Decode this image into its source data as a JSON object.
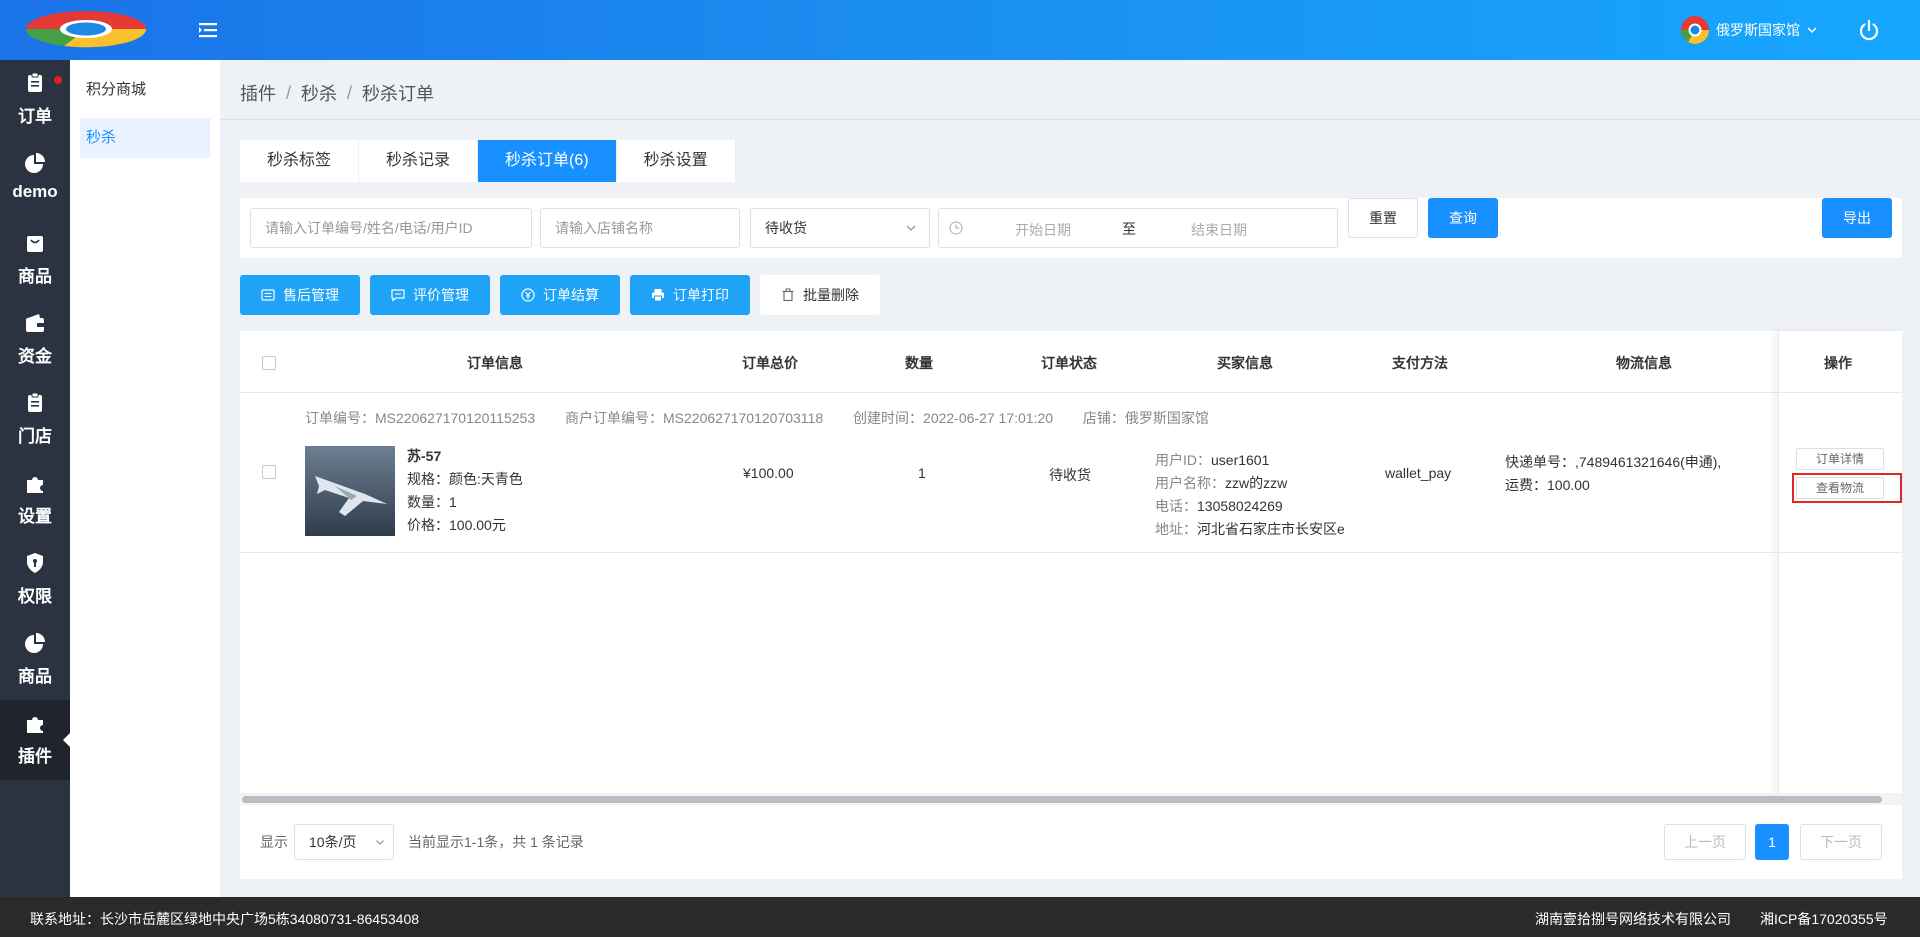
{
  "header": {
    "store_name": "俄罗斯国家馆"
  },
  "leftnav": {
    "items": [
      {
        "label": "订单"
      },
      {
        "label": "demo"
      },
      {
        "label": "商品"
      },
      {
        "label": "资金"
      },
      {
        "label": "门店"
      },
      {
        "label": "设置"
      },
      {
        "label": "权限"
      },
      {
        "label": "商品"
      },
      {
        "label": "插件"
      }
    ]
  },
  "subnav": {
    "items": [
      {
        "label": "积分商城"
      },
      {
        "label": "秒杀"
      }
    ]
  },
  "breadcrumb": {
    "items": [
      "插件",
      "秒杀",
      "秒杀订单"
    ],
    "sep": "/"
  },
  "tabs": [
    {
      "label": "秒杀标签"
    },
    {
      "label": "秒杀记录"
    },
    {
      "label": "秒杀订单(6)"
    },
    {
      "label": "秒杀设置"
    }
  ],
  "filter": {
    "order_placeholder": "请输入订单编号/姓名/电话/用户ID",
    "store_placeholder": "请输入店铺名称",
    "status_value": "待收货",
    "start_date_placeholder": "开始日期",
    "date_sep": "至",
    "end_date_placeholder": "结束日期",
    "reset_label": "重置",
    "query_label": "查询",
    "export_label": "导出"
  },
  "actions": {
    "after_sale": "售后管理",
    "review": "评价管理",
    "settle": "订单结算",
    "print": "订单打印",
    "batch_delete": "批量删除"
  },
  "table": {
    "headers": {
      "info": "订单信息",
      "total": "订单总价",
      "qty": "数量",
      "status": "订单状态",
      "buyer": "买家信息",
      "pay": "支付方法",
      "logistics": "物流信息",
      "ops": "操作"
    },
    "order": {
      "order_no": "订单编号：MS220627170120115253",
      "merchant_no": "商户订单编号：MS220627170120703118",
      "created": "创建时间：2022-06-27 17:01:20",
      "store": "店铺：俄罗斯国家馆",
      "product_name": "苏-57",
      "spec": "规格：颜色:天青色",
      "count": "数量：1",
      "price": "价格：100.00元",
      "total": "¥100.00",
      "qty": "1",
      "status": "待收货",
      "buyer_id_k": "用户ID：",
      "buyer_id_v": "user1601",
      "buyer_name_k": "用户名称：",
      "buyer_name_v": "zzw的zzw",
      "buyer_phone_k": "电话：",
      "buyer_phone_v": "13058024269",
      "buyer_addr_k": "地址：",
      "buyer_addr_v": "河北省石家庄市长安区e",
      "pay_method": "wallet_pay",
      "tracking": "快递单号：,7489461321646(申通),",
      "freight": "运费：100.00",
      "detail_btn": "订单详情",
      "logistics_btn": "查看物流"
    }
  },
  "pager": {
    "show_label": "显示",
    "page_size": "10条/页",
    "summary": "当前显示1-1条，共 1 条记录",
    "prev": "上一页",
    "current": "1",
    "next": "下一页"
  },
  "footer": {
    "address": "联系地址：长沙市岳麓区绿地中央广场5栋34080731-86453408",
    "company": "湖南壹拾捌号网络技术有限公司",
    "icp": "湘ICP备17020355号"
  },
  "colors": {
    "primary": "#1890ff",
    "action": "#1fa3f7",
    "nav_bg": "#2b3340",
    "highlight": "#e3242b"
  }
}
